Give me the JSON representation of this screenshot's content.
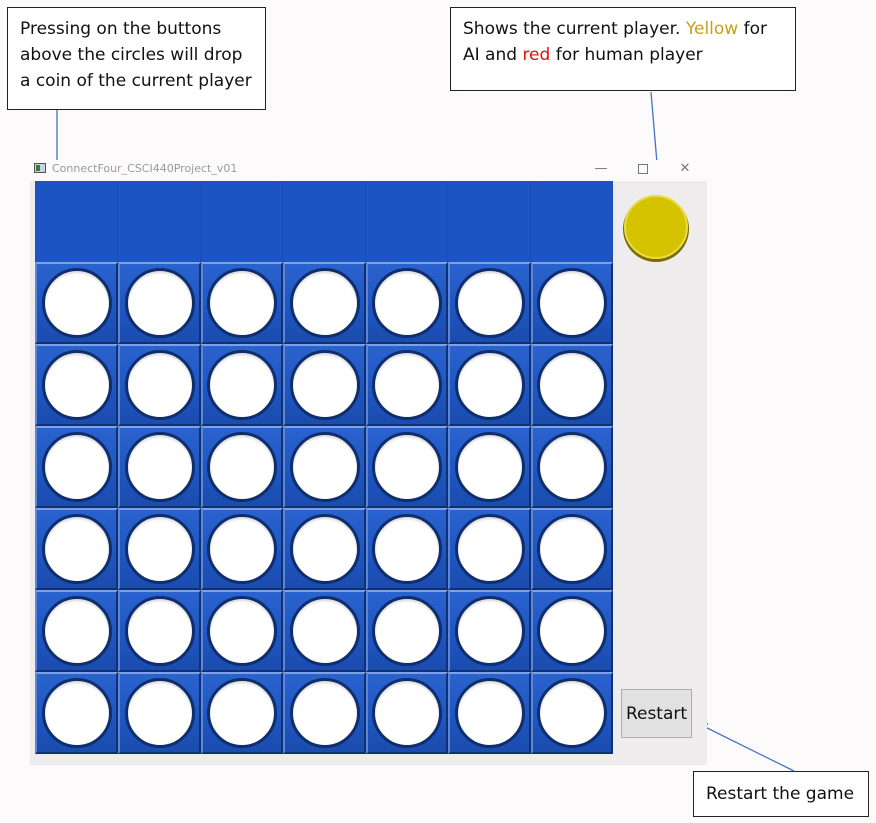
{
  "callouts": {
    "buttons": {
      "line1": "Pressing on the buttons",
      "line2": "above the circles will drop",
      "line3": "a coin of the current player"
    },
    "player": {
      "part1": "Shows the current player. ",
      "yellow_word": "Yellow",
      "part2": " for",
      "part3": "AI and ",
      "red_word": "red",
      "part4": " for human player",
      "yellow_color": "#c8a018",
      "red_color": "#e01010"
    },
    "restart": {
      "text": "Restart the game"
    }
  },
  "window": {
    "title": "ConnectFour_CSCI440Project_v01",
    "minimize_glyph": "—",
    "close_glyph": "✕"
  },
  "board": {
    "columns": 7,
    "rows": 6,
    "cell_color": "#1f58c4",
    "hole_color": "#ffffff"
  },
  "current_player": {
    "player": "AI",
    "color": "#d6c300"
  },
  "restart_button": {
    "label": "Restart"
  }
}
